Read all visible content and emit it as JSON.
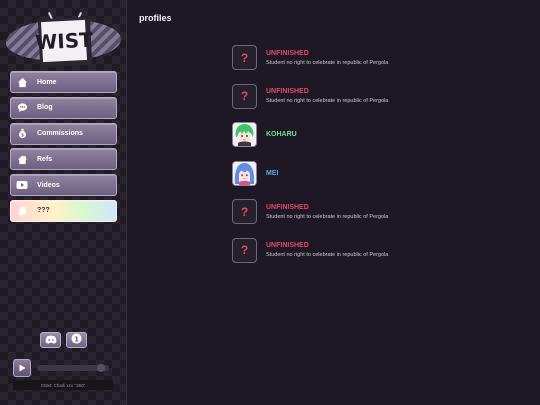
{
  "logo": {
    "text": "WIST"
  },
  "nav": {
    "items": [
      {
        "label": "Home",
        "icon": "home-icon"
      },
      {
        "label": "Blog",
        "icon": "chat-icon"
      },
      {
        "label": "Commissions",
        "icon": "money-bag-icon"
      },
      {
        "label": "Refs",
        "icon": "house-icon"
      },
      {
        "label": "Videos",
        "icon": "video-icon"
      },
      {
        "label": "???",
        "icon": "ghost-icon"
      }
    ]
  },
  "social": [
    {
      "icon": "discord-icon"
    },
    {
      "icon": "info-icon"
    }
  ],
  "player": {
    "now_playing": "SGM: Charli xcx \"360\""
  },
  "main": {
    "title": "profiles",
    "profiles": [
      {
        "name": "UNFINISHED",
        "desc": "Student no right to celebrate in republic of Pergola",
        "name_color": "#e0486f",
        "thumb": "?"
      },
      {
        "name": "UNFINISHED",
        "desc": "Student no right to celebrate in republic of Pergola",
        "name_color": "#e0486f",
        "thumb": "?"
      },
      {
        "name": "KOHARU",
        "desc": "",
        "name_color": "#6fe08a",
        "thumb": "koharu-avatar"
      },
      {
        "name": "MEI",
        "desc": "",
        "name_color": "#5fa8e8",
        "thumb": "mei-avatar"
      },
      {
        "name": "UNFINISHED",
        "desc": "Student no right to celebrate in republic of Pergola",
        "name_color": "#e0486f",
        "thumb": "?"
      },
      {
        "name": "UNFINISHED",
        "desc": "Student no right to celebrate in republic of Pergola",
        "name_color": "#e0486f",
        "thumb": "?"
      }
    ]
  }
}
